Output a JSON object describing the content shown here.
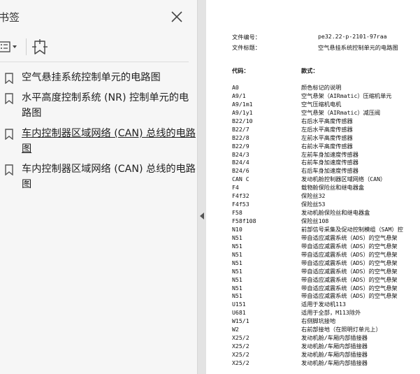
{
  "sidebar": {
    "title": "书签",
    "bookmarks": [
      {
        "label": "空气悬挂系统控制单元的电路图"
      },
      {
        "label": "水平高度控制系统 (NR) 控制单元的电路图"
      },
      {
        "label": "车内控制器区域网络 (CAN) 总线的电路图"
      },
      {
        "label": "车内控制器区域网络 (CAN) 总线的电路图"
      }
    ]
  },
  "document": {
    "file_number_label": "文件编号：",
    "file_number": "pe32.22-p-2101-97raa",
    "file_title_label": "文件标题：",
    "file_title": "空气悬挂系统控制单元的电路图",
    "code_header": "代码：",
    "desc_header": "款式：",
    "rows": [
      {
        "code": "A0",
        "desc": "颜色标记的说明"
      },
      {
        "code": "A9/1",
        "desc": "空气悬架（AIRmatic）压缩机单元"
      },
      {
        "code": "A9/1m1",
        "desc": "空气压缩机电机"
      },
      {
        "code": "A9/1y1",
        "desc": "空气悬架（AIRmatic）减压阀"
      },
      {
        "code": "B22/10",
        "desc": "右后水平高度传感器"
      },
      {
        "code": "B22/7",
        "desc": "左后水平高度传感器"
      },
      {
        "code": "B22/8",
        "desc": "左前水平高度传感器"
      },
      {
        "code": "B22/9",
        "desc": "右前水平高度传感器"
      },
      {
        "code": "B24/3",
        "desc": "左前车身加速度传感器"
      },
      {
        "code": "B24/4",
        "desc": "右前车身加速度传感器"
      },
      {
        "code": "B24/6",
        "desc": "右后车身加速度传感器"
      },
      {
        "code": "CAN C",
        "desc": "发动机舱控制器区域网络（CAN）"
      },
      {
        "code": "F4",
        "desc": "载物舱保险丝和继电器盒"
      },
      {
        "code": "F4f32",
        "desc": "保险丝32"
      },
      {
        "code": "F4f53",
        "desc": "保险丝53"
      },
      {
        "code": "F58",
        "desc": "发动机舱保险丝和继电器盒"
      },
      {
        "code": "F58f108",
        "desc": "保险丝108"
      },
      {
        "code": "N10",
        "desc": "前部信号采集及促动控制模组（SAM）控"
      },
      {
        "code": "N51",
        "desc": "带自适应减震系统（ADS）的空气悬架"
      },
      {
        "code": "N51",
        "desc": "带自适应减震系统（ADS）的空气悬架"
      },
      {
        "code": "N51",
        "desc": "带自适应减震系统（ADS）的空气悬架"
      },
      {
        "code": "N51",
        "desc": "带自适应减震系统（ADS）的空气悬架"
      },
      {
        "code": "N51",
        "desc": "带自适应减震系统（ADS）的空气悬架"
      },
      {
        "code": "N51",
        "desc": "带自适应减震系统（ADS）的空气悬架"
      },
      {
        "code": "N51",
        "desc": "带自适应减震系统（ADS）的空气悬架"
      },
      {
        "code": "N51",
        "desc": "带自适应减震系统（ADS）的空气悬架"
      },
      {
        "code": "U151",
        "desc": "适用于发动机113"
      },
      {
        "code": "U681",
        "desc": "适用于全部，M113除外"
      },
      {
        "code": "W15/1",
        "desc": "右侧脚坑接地"
      },
      {
        "code": "W2",
        "desc": "右前部接地（在照明灯单元上）"
      },
      {
        "code": "X25/2",
        "desc": "发动机舱/车厢内部插接器"
      },
      {
        "code": "X25/2",
        "desc": "发动机舱/车厢内部插接器"
      },
      {
        "code": "X25/2",
        "desc": "发动机舱/车厢内部插接器"
      },
      {
        "code": "X25/2",
        "desc": "发动机舱/车厢内部插接器"
      }
    ]
  },
  "colors": {
    "panel_bg": "#f6f6f6",
    "splitter": "#e3e3e3",
    "faded_text": "#a9a9a9"
  }
}
